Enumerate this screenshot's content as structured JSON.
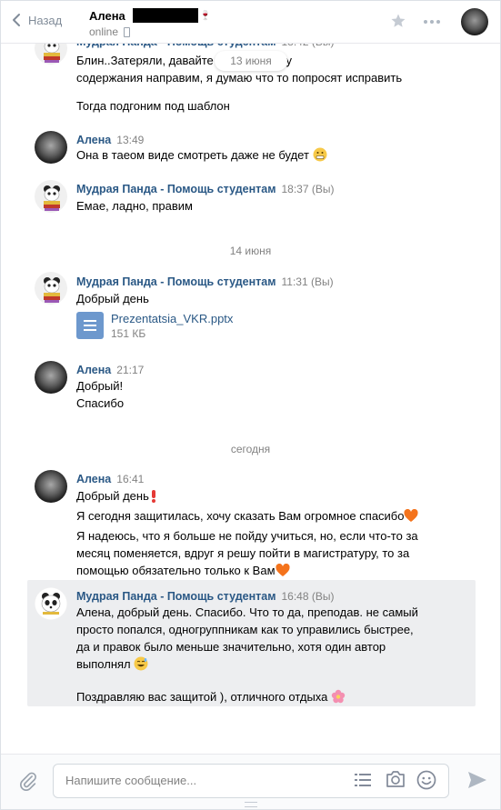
{
  "header": {
    "back_label": "Назад",
    "contact_name": "Алена",
    "status": "online"
  },
  "date_pill": "13 июня",
  "messages": [
    {
      "author": "Мудрая Панда - Помощь студентам",
      "time": "18:42 (Вы)",
      "lines": [
        "Блин..Затеряли, давайте т на проверку",
        "содержания направим, я думаю что то попросят исправить"
      ],
      "extra": "Тогда подгоним под шаблон"
    },
    {
      "author": "Алена",
      "time": "13:49",
      "lines": [
        "Она в таеом виде смотреть даже не будет"
      ]
    },
    {
      "author": "Мудрая Панда - Помощь студентам",
      "time": "18:37 (Вы)",
      "lines": [
        "Емае, ладно, правим"
      ]
    },
    {
      "author": "Мудрая Панда - Помощь студентам",
      "time": "11:31 (Вы)",
      "lines": [
        "Добрый день"
      ]
    },
    {
      "author": "Алена",
      "time": "21:17",
      "lines": [
        "Добрый!",
        "Спасибо"
      ]
    },
    {
      "author": "Алена",
      "time": "16:41",
      "lines": [
        "Добрый день",
        "Я сегодня защитилась, хочу сказать Вам огромное спасибо",
        "Я надеюсь, что я больше не пойду учиться, но, если что-то за",
        "месяц поменяется, вдруг я решу пойти в магистратуру, то за",
        "помощью обязательно только к Вам"
      ]
    },
    {
      "author": "Мудрая Панда - Помощь студентам",
      "time": "16:48 (Вы)",
      "lines": [
        "Алена, добрый день. Спасибо. Что то да, преподав. не самый",
        "просто попался, одногруппникам как то управились быстрее,",
        "да и правок было меньше значительно, хотя один автор",
        "выполнял"
      ],
      "extra": "Поздравляю вас защитой ), отличного отдыха"
    }
  ],
  "date_separators": [
    "14 июня",
    "сегодня"
  ],
  "file": {
    "name": "Prezentatsia_VKR.pptx",
    "size": "151 КБ",
    "icon": "document-icon"
  },
  "composer": {
    "placeholder": "Напишите сообщение..."
  },
  "colors": {
    "link": "#2a5885",
    "meta": "#828282",
    "file_icon": "#6d98cd",
    "selected": "#edeef0"
  }
}
